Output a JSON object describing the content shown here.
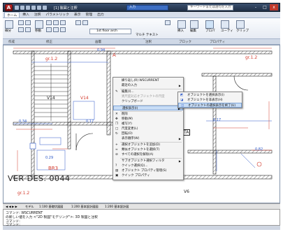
{
  "app": {
    "menu_button": "A",
    "title": "[1] 製図と注釈",
    "search_banner": "入力",
    "help_search_placeholder": "キーワードまたは語句を入力",
    "window_controls": [
      "-",
      "□",
      "x"
    ]
  },
  "ribbon_tabs": [
    "ホーム",
    "挿入",
    "注釈",
    "パラメトリック",
    "表示",
    "管理",
    "出力"
  ],
  "ribbon": {
    "draw_label": "線分",
    "modify_label": "移動",
    "layer_combo": "1st floor arch",
    "text_big": "A",
    "text_label": "マルチ テキスト",
    "insert_label": "挿入",
    "edit_label": "編集",
    "properties_label": "プロパ",
    "utilities_label": "ユーティ",
    "clipboard_label": "クリップ",
    "panels": [
      "作成",
      "修正",
      "画層",
      "注釈",
      "ブロック",
      "プロパティ"
    ]
  },
  "drawing_labels": {
    "dim_top": "0.94",
    "gr_left": "gr.1.2",
    "gr_right": "gr.1.2",
    "v14_a": "V14",
    "v14_b": "V14",
    "dim_left": "0.34",
    "dim_mid": "0.17",
    "dim_right": "0.17",
    "dim_small": "0.29",
    "dim_right2": "0.82",
    "room_br3": "BR3",
    "ver_des": "VER DES. 0044",
    "v6": "V6",
    "gr_low": "gr.1.2",
    "a_tag": "A",
    "ta_tag": "TA"
  },
  "context_menu": {
    "items": [
      {
        "label": "繰り返し(R) WSCURRENT",
        "arrow": false,
        "icon": ""
      },
      {
        "label": "最近の入力",
        "arrow": true,
        "icon": ""
      },
      {
        "label": "編集(I)...",
        "arrow": false,
        "icon": "✎"
      },
      {
        "label": "異尺度対応オブジェクトの尺度",
        "arrow": true,
        "icon": ""
      },
      {
        "label": "クリップボード",
        "arrow": true,
        "icon": ""
      },
      {
        "label": "選択表示(I)",
        "arrow": true,
        "icon": ""
      },
      {
        "label": "削除",
        "arrow": false,
        "icon": "✕"
      },
      {
        "label": "移動(M)",
        "arrow": false,
        "icon": "✥"
      },
      {
        "label": "複写(Y)",
        "arrow": false,
        "icon": "❐"
      },
      {
        "label": "尺度変更(L)",
        "arrow": false,
        "icon": "□"
      },
      {
        "label": "回転(O)",
        "arrow": false,
        "icon": "↻"
      },
      {
        "label": "表示順序(W)",
        "arrow": true,
        "icon": ""
      },
      {
        "label": "選択オブジェクトを追加(D)",
        "arrow": false,
        "icon": "+"
      },
      {
        "label": "類似オブジェクトを選択(T)",
        "arrow": false,
        "icon": "≈"
      },
      {
        "label": "すべての選択を解除(A)",
        "arrow": false,
        "icon": "⊘"
      },
      {
        "label": "サブオブジェクト選択フィルタ",
        "arrow": true,
        "icon": ""
      },
      {
        "label": "クイック選択(Q)...",
        "arrow": false,
        "icon": "?"
      },
      {
        "label": "オブジェクト プロパティ管理(S)",
        "arrow": false,
        "icon": "▤"
      },
      {
        "label": "クイック プロパティ",
        "arrow": false,
        "icon": "▣"
      }
    ]
  },
  "submenu": {
    "items": [
      {
        "label": "オブジェクトを選択表示(I)",
        "icon": "◩"
      },
      {
        "label": "オブジェクトを非表示(H)",
        "icon": "◪"
      },
      {
        "label": "オブジェクトの選択表示を終了(U)",
        "icon": "◫"
      }
    ]
  },
  "layout_tabs": {
    "model": "モデル",
    "tab1": "1:100 基礎伏図図",
    "tab2": "1:200 基本設計図図",
    "tab3": "1:200 基本設計図"
  },
  "command_line": {
    "line1": "コマンド: WSCURRENT",
    "line2": "の新しい値を入力 <\"2D 製図\"モデリング\">: 3D 製図と注釈",
    "line3": "コマンド:",
    "line4": "コマンド:"
  },
  "colors": {
    "wall": "#222222",
    "dim_red": "#d33a2c",
    "dim_blue": "#2b57c7",
    "hatch": "#333333"
  }
}
